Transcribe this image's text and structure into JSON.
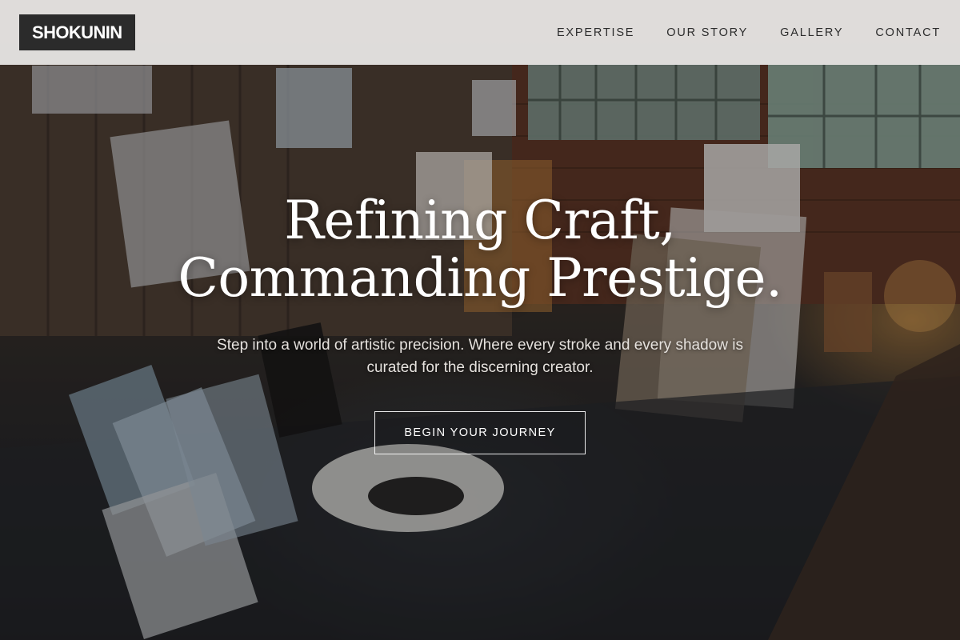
{
  "brand": {
    "logo_text": "SHOKUNIN"
  },
  "nav": {
    "items": [
      {
        "label": "EXPERTISE"
      },
      {
        "label": "OUR STORY"
      },
      {
        "label": "GALLERY"
      },
      {
        "label": "CONTACT"
      }
    ]
  },
  "hero": {
    "headline_line1": "Refining Craft,",
    "headline_line2": "Commanding Prestige.",
    "subtext": "Step into a world of artistic precision. Where every stroke and every shadow is curated for the discerning creator.",
    "cta_label": "BEGIN YOUR JOURNEY",
    "background_description_icon": "art-studio-photo"
  },
  "colors": {
    "header_bg": "#ECEAE8",
    "logo_bg": "#2B2B2B",
    "nav_text": "#2C2C2C",
    "hero_text": "#FFFFFF"
  }
}
